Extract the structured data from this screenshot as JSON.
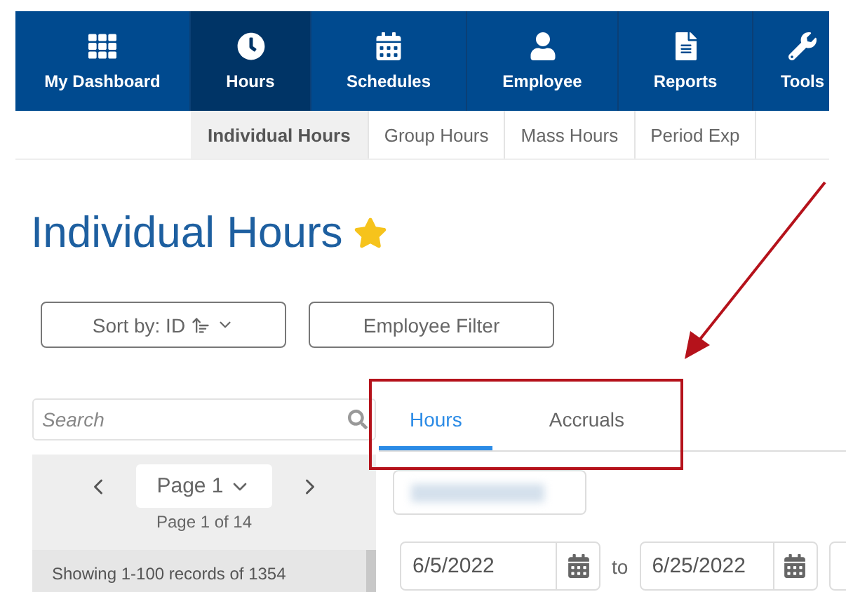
{
  "nav": [
    {
      "label": "My Dashboard",
      "selected": false
    },
    {
      "label": "Hours",
      "selected": true
    },
    {
      "label": "Schedules",
      "selected": false
    },
    {
      "label": "Employee",
      "selected": false
    },
    {
      "label": "Reports",
      "selected": false
    },
    {
      "label": "Tools",
      "selected": false
    }
  ],
  "subnav": [
    {
      "label": "Individual Hours",
      "selected": true
    },
    {
      "label": "Group Hours",
      "selected": false
    },
    {
      "label": "Mass Hours",
      "selected": false
    },
    {
      "label": "Period Exp",
      "selected": false
    }
  ],
  "page_title": "Individual Hours",
  "favorite": true,
  "sort_button": "Sort by: ID",
  "filter_button": "Employee Filter",
  "search": {
    "placeholder": "Search"
  },
  "pager": {
    "page": "Page 1",
    "summary": "Page 1 of 14"
  },
  "records": "Showing 1-100 records of 1354",
  "tabs": [
    {
      "label": "Hours",
      "selected": true
    },
    {
      "label": "Accruals",
      "selected": false
    }
  ],
  "date_range": {
    "from": "6/5/2022",
    "separator": "to",
    "to": "6/25/2022"
  }
}
